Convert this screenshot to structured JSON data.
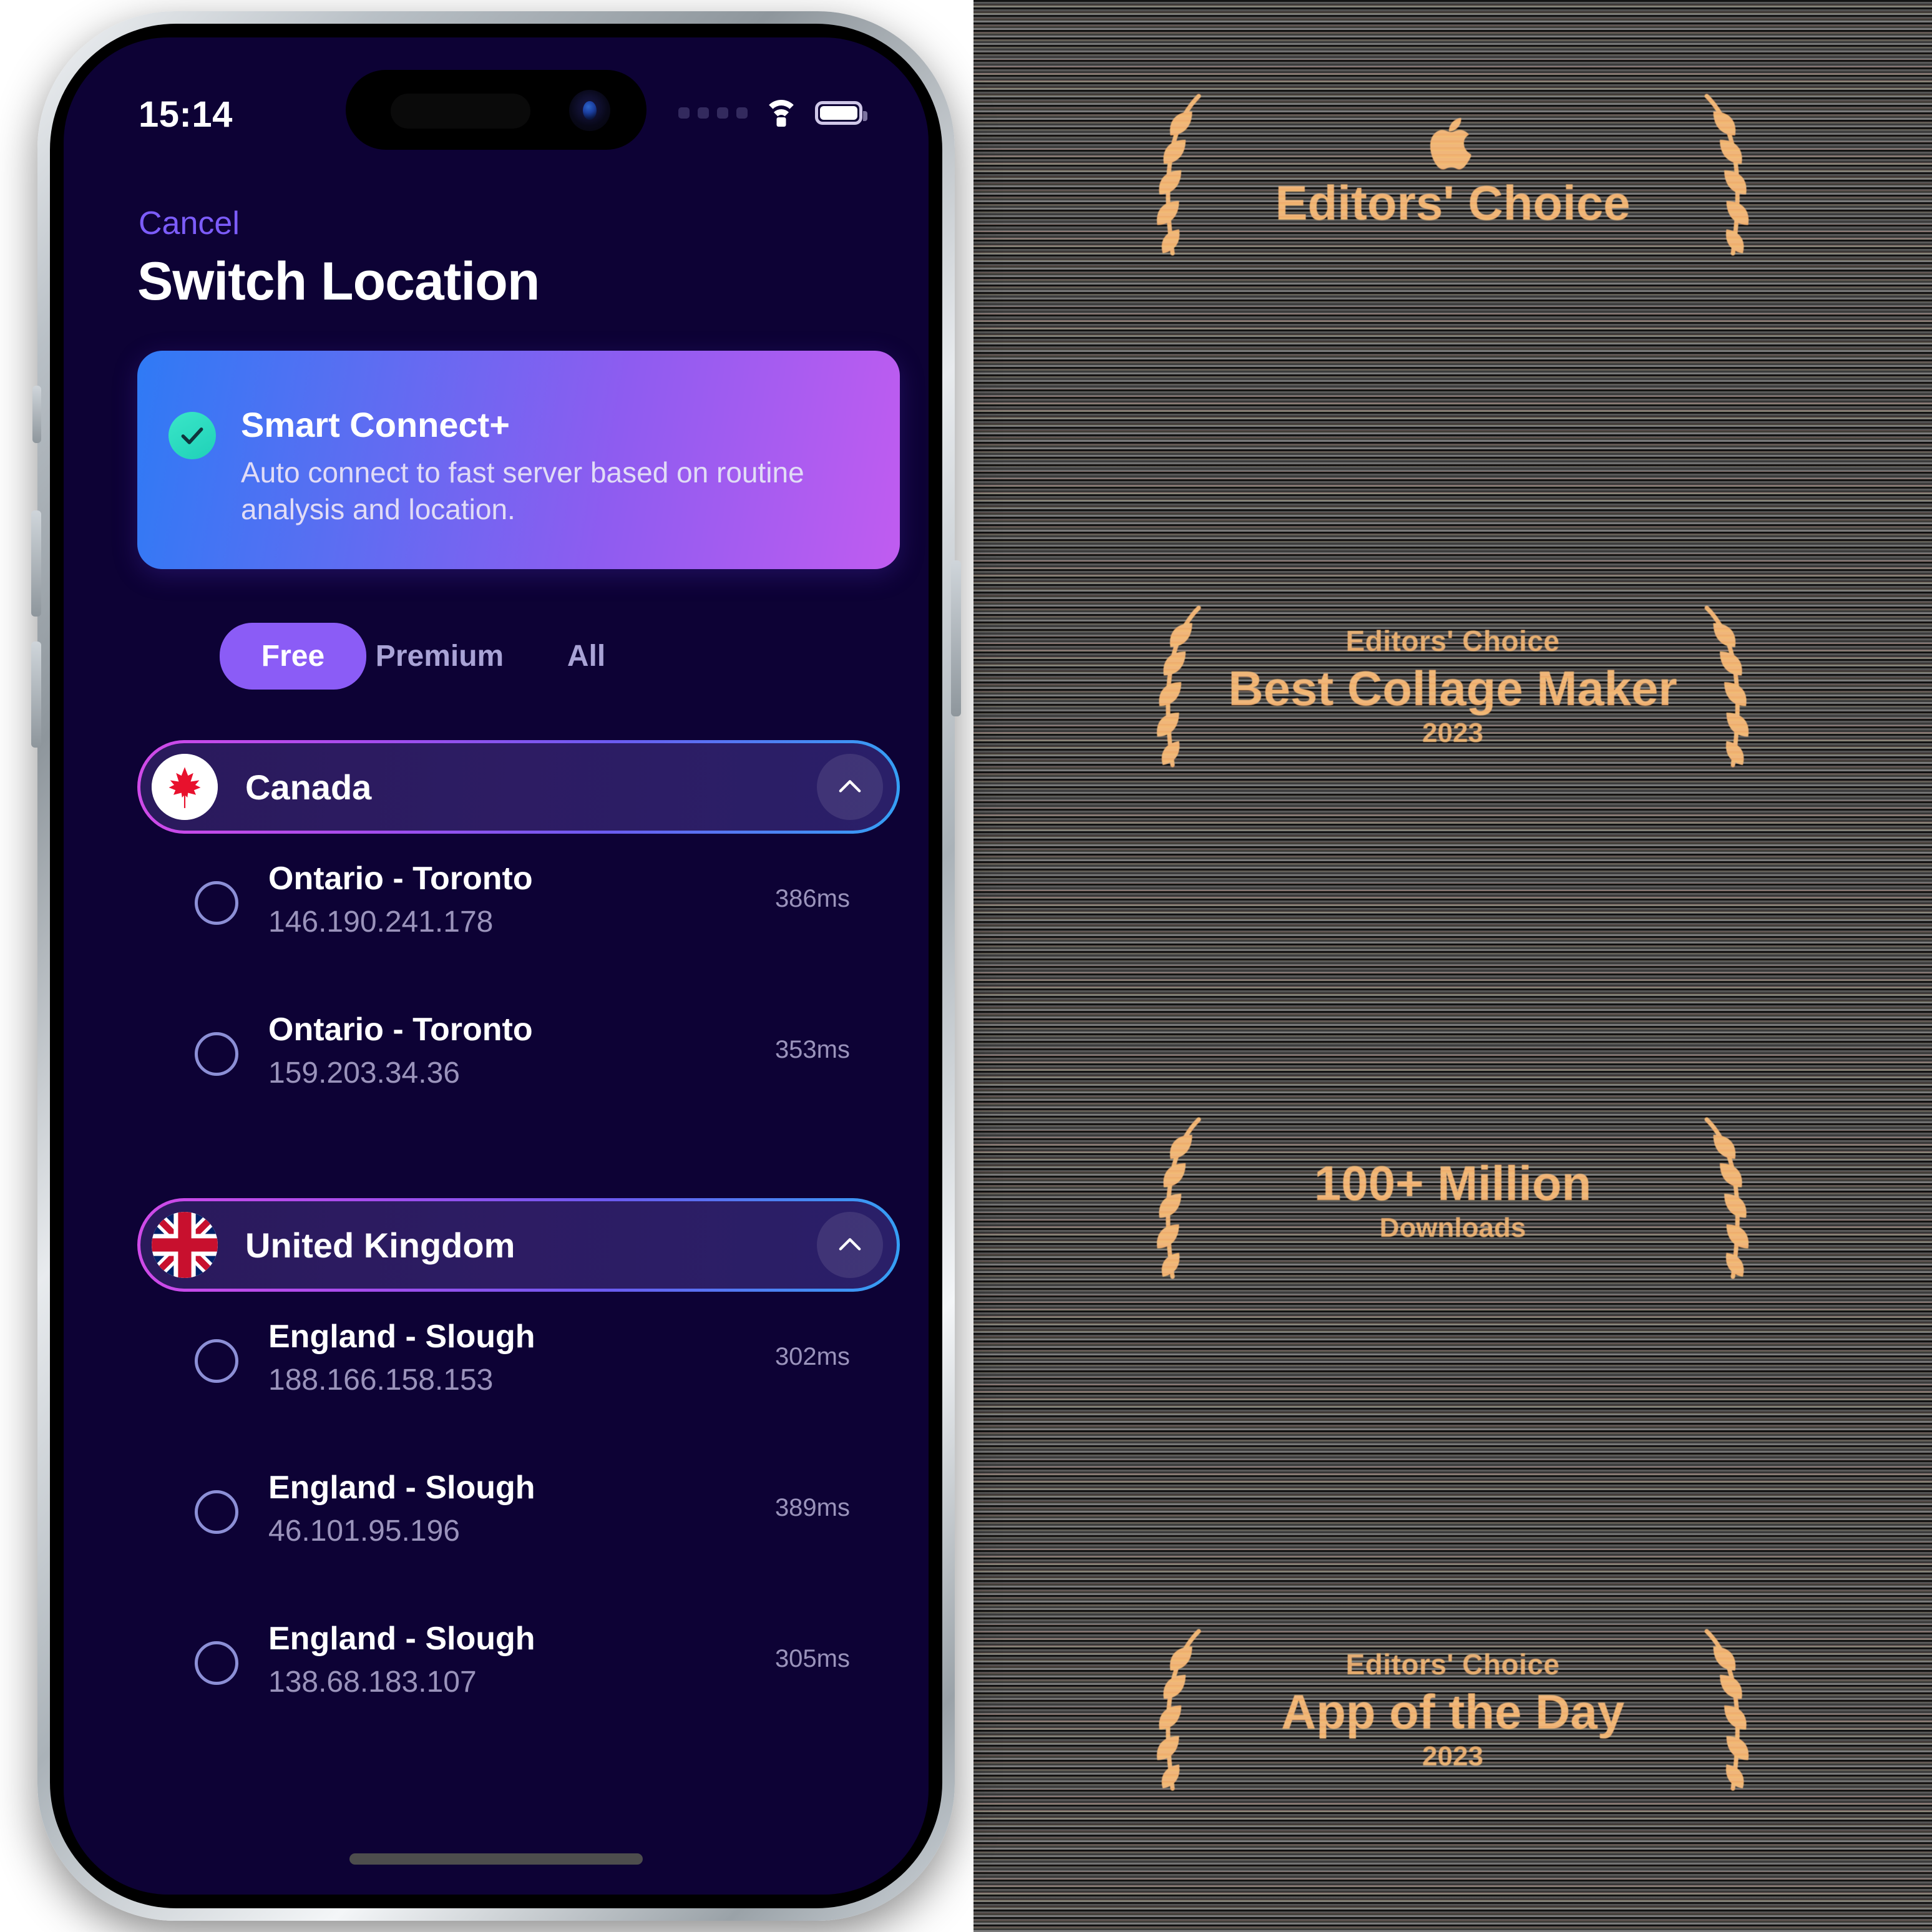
{
  "status_bar": {
    "time": "15:14",
    "signal_icon": "signal-dots-icon",
    "wifi_icon": "wifi-icon",
    "battery_icon": "battery-full-icon"
  },
  "nav": {
    "cancel_label": "Cancel",
    "title": "Switch Location"
  },
  "smart_connect": {
    "check_icon": "check-circle-icon",
    "title": "Smart Connect+",
    "description": "Auto connect to fast server based on routine analysis and location.",
    "gradient_start": "#2f7af5",
    "gradient_end": "#c05cf0",
    "check_color": "#2fdfc2"
  },
  "filters": {
    "active": "Free",
    "tabs": [
      {
        "label": "Free",
        "active": true
      },
      {
        "label": "Premium",
        "active": false
      },
      {
        "label": "All",
        "active": false
      }
    ],
    "active_pill_color": "#8b5cf6",
    "inactive_text_color": "#a9a3d6"
  },
  "countries": [
    {
      "name": "Canada",
      "flag_icon": "flag-canada-icon",
      "expanded": true,
      "collapse_icon": "chevron-up-icon",
      "servers": [
        {
          "name": "Ontario - Toronto",
          "ip": "146.190.241.178",
          "latency": "386ms",
          "selected": false,
          "radio_icon": "radio-unchecked-icon"
        },
        {
          "name": "Ontario - Toronto",
          "ip": "159.203.34.36",
          "latency": "353ms",
          "selected": false,
          "radio_icon": "radio-unchecked-icon"
        }
      ]
    },
    {
      "name": "United Kingdom",
      "flag_icon": "flag-united-kingdom-icon",
      "expanded": true,
      "collapse_icon": "chevron-up-icon",
      "servers": [
        {
          "name": "England - Slough",
          "ip": "188.166.158.153",
          "latency": "302ms",
          "selected": false,
          "radio_icon": "radio-unchecked-icon"
        },
        {
          "name": "England - Slough",
          "ip": "46.101.95.196",
          "latency": "389ms",
          "selected": false,
          "radio_icon": "radio-unchecked-icon"
        },
        {
          "name": "England - Slough",
          "ip": "138.68.183.107",
          "latency": "305ms",
          "selected": false,
          "radio_icon": "radio-unchecked-icon"
        }
      ]
    }
  ],
  "home_indicator": "home-indicator",
  "awards": [
    {
      "eyebrow": "",
      "apple_logo": "apple-logo-icon",
      "main": "Editors' Choice",
      "sub": "",
      "laurel_icon": "laurel-wreath-icon"
    },
    {
      "eyebrow": "Editors' Choice",
      "apple_logo": "",
      "main": "Best Collage Maker",
      "sub": "2023",
      "laurel_icon": "laurel-wreath-icon"
    },
    {
      "eyebrow": "",
      "apple_logo": "",
      "main": "100+ Million",
      "sub": "Downloads",
      "laurel_icon": "laurel-wreath-icon"
    },
    {
      "eyebrow": "Editors' Choice",
      "apple_logo": "",
      "main": "App of the Day",
      "sub": "2023",
      "laurel_icon": "laurel-wreath-icon"
    }
  ],
  "theme": {
    "screen_bg": "#0d0235",
    "accent_purple": "#8b5cf6",
    "cancel_blue": "#7c5cfa",
    "muted_text": "#9a93bb",
    "award_gold": "#f0b67a"
  }
}
